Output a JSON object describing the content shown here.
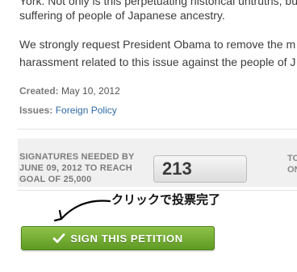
{
  "petition": {
    "paragraph1_line1": "York. Not only is this perpetuating historical untruths, but",
    "paragraph1_line2": "suffering of people of Japanese ancestry.",
    "paragraph2_line1": "We strongly request President Obama to remove the m",
    "paragraph2_line2": "harassment related to this issue against the people of J"
  },
  "meta": {
    "created_label": "Created:",
    "created_value": "May 10, 2012",
    "issues_label": "Issues:",
    "issues_value": "Foreign Policy"
  },
  "signatures": {
    "needed_label": "SIGNATURES NEEDED BY JUNE 09, 2012 TO REACH GOAL OF 25,000",
    "count": "213",
    "right_line1": "TO",
    "right_line2": "ON"
  },
  "annotation": {
    "text": "クリックで投票完了"
  },
  "button": {
    "label": "SIGN THIS PETITION",
    "color_top": "#8fc24a",
    "color_bottom": "#5e9a23",
    "icon": "checkmark-icon"
  }
}
